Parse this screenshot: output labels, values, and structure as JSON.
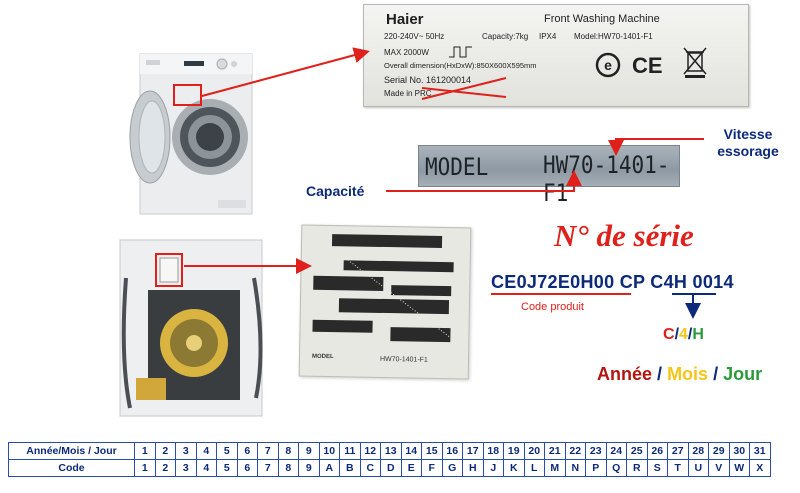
{
  "rating_label": {
    "brand": "Haier",
    "product": "Front Washing Machine",
    "voltage": "220-240V~ 50Hz",
    "capacity": "Capacity:7kg",
    "ipx": "IPX4",
    "model": "Model:HW70-1401-F1",
    "max_power": "MAX  2000W",
    "dimensions": "Overall dimension(HxDxW):850X600X595mm",
    "serial": "Serial No. 161200014",
    "made": "Made in PRC"
  },
  "model_plate": {
    "label": "MODEL",
    "value": "HW70-1401-F1"
  },
  "barcode_label": {
    "footer_label": "MODEL",
    "footer_value": "HW70-1401-F1"
  },
  "callouts": {
    "vitesse": "Vitesse essorage",
    "capacite": "Capacité"
  },
  "serial_section": {
    "heading": "N° de série",
    "code_part1": "CE0J72E0H00",
    "code_part2": "CP",
    "code_part3": "C4H",
    "code_part4": "0014",
    "code_produit": "Code produit",
    "c": "C",
    "four": "4",
    "h": "H",
    "sep": "/",
    "annee": "Année",
    "mois": "Mois",
    "jour": "Jour"
  },
  "colors": {
    "red": "#e0201a",
    "navy": "#0d2a7a",
    "yellow": "#f5c518",
    "green": "#2a9a3c"
  },
  "table": {
    "row1_header": "Année/Mois / Jour",
    "row2_header": "Code",
    "numbers": [
      "1",
      "2",
      "3",
      "4",
      "5",
      "6",
      "7",
      "8",
      "9",
      "10",
      "11",
      "12",
      "13",
      "14",
      "15",
      "16",
      "17",
      "18",
      "19",
      "20",
      "21",
      "22",
      "23",
      "24",
      "25",
      "26",
      "27",
      "28",
      "29",
      "30",
      "31"
    ],
    "codes": [
      "1",
      "2",
      "3",
      "4",
      "5",
      "6",
      "7",
      "8",
      "9",
      "A",
      "B",
      "C",
      "D",
      "E",
      "F",
      "G",
      "H",
      "J",
      "K",
      "L",
      "M",
      "N",
      "P",
      "Q",
      "R",
      "S",
      "T",
      "U",
      "V",
      "W",
      "X"
    ]
  }
}
